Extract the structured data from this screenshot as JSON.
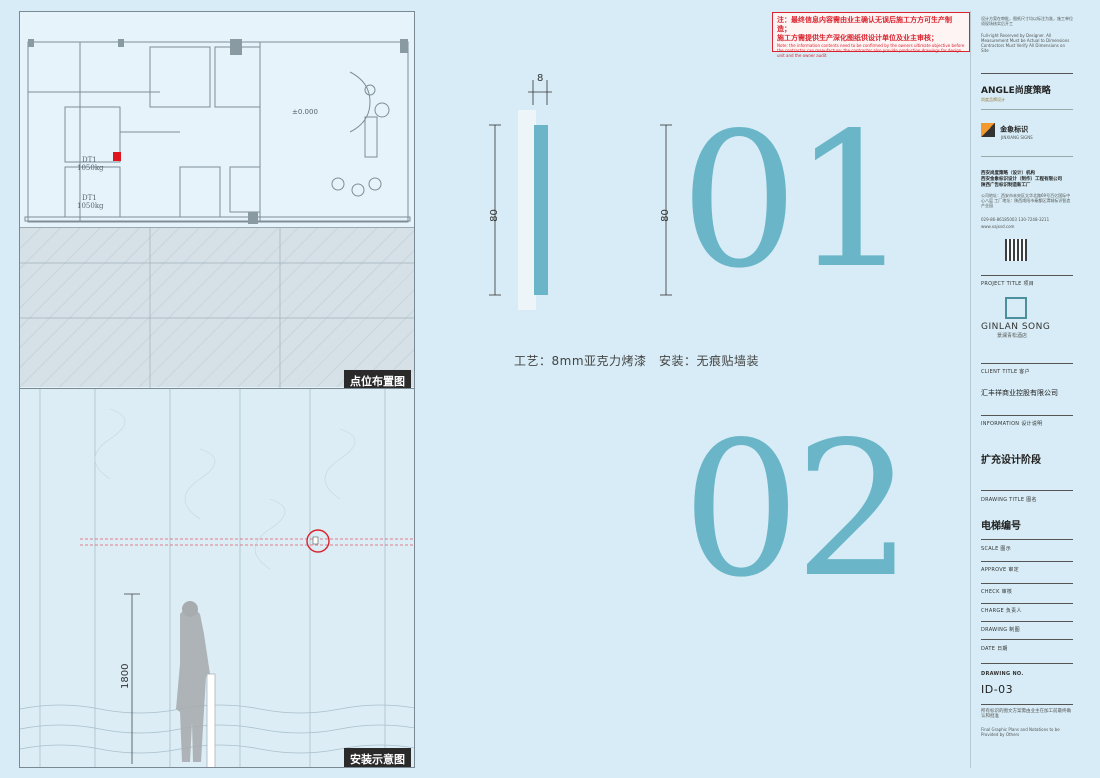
{
  "notice": {
    "line1": "注：最终信息内容需由业主确认无误后施工方方可生产制造；",
    "line2": "施工方需提供生产深化图纸供设计单位及业主审核；",
    "en": "Note: the information contents need to be confirmed by the owners ultimate objective before the contractor can manufacture; the contractor also provide production drawings for design unit and the owner audit"
  },
  "panels": {
    "plan_label": "点位布置图",
    "elev_label": "安装示意图",
    "plan_level": "±0.000",
    "elevator1": "DT1\n1050kg",
    "elevator2": "DT1\n1050kg",
    "height_dim": "1800"
  },
  "detail": {
    "width_dim": "8",
    "height_dim_left": "80",
    "height_dim_right": "80",
    "num1": "01",
    "num2": "02",
    "craft": "工艺：8mm亚克力烤漆",
    "install": "安装：无痕贴墙装"
  },
  "titleblock": {
    "top_note_cn": "设计方案在审批，图纸尺寸均以标注为准，施工单位须现场核实后开工",
    "top_note_en": "Full-right Reserved by Designer. All Measurement Must be Actual to Dimensions Contractors Must Verify All Dimensions on Site",
    "brand1": "ANGLE尚度策略",
    "brand1_sub": "尚度品牌设计",
    "brand2": "金象标识",
    "brand2_sub": "JINXIANG SIGNS",
    "company1": "西安尚度策略（设计）机构",
    "company2": "西安金象标识设计（制作）工程有限公司",
    "company3": "陕西广告标识制造新工厂",
    "address": "公司地址：西安市未央区太华北路69号百亿国际中心八层  工厂地址：陕西咸阳市秦都区渭城标识智造产业园",
    "phone": "029-86-86185003  130-7248-3211",
    "web": "www.xajxsd.com",
    "project_title_head": "PROJECT TITLE 项目",
    "project_en": "GINLAN SONG",
    "project_cn": "景澜青松酒店",
    "client_title_head": "CLIENT TITLE 客户",
    "client": "汇丰祥商业控股有限公司",
    "information_head": "INFORMATION 设计说明",
    "information": "扩充设计阶段",
    "drawing_title_head": "DRAWING TITLE 图名",
    "drawing_title": "电梯编号",
    "scale_head": "SCALE 图示",
    "approve_head": "APPROVE 审定",
    "check_head": "CHECK 审核",
    "charge_head": "CHARGE 负责人",
    "drawing_head": "DRAWING 制图",
    "date_head": "DATE 日期",
    "drawing_no_head": "DRAWING NO.",
    "drawing_no": "ID-03",
    "bottom_note_cn": "所有标识的图文方案需由业主在加工前最终确认和批准",
    "bottom_note_en": "Final Graphic Plans and Notations to be Provided by Others"
  },
  "colors": {
    "background": "#d7ecf6",
    "accent": "#6ab6c8",
    "warning": "#d9232e"
  }
}
